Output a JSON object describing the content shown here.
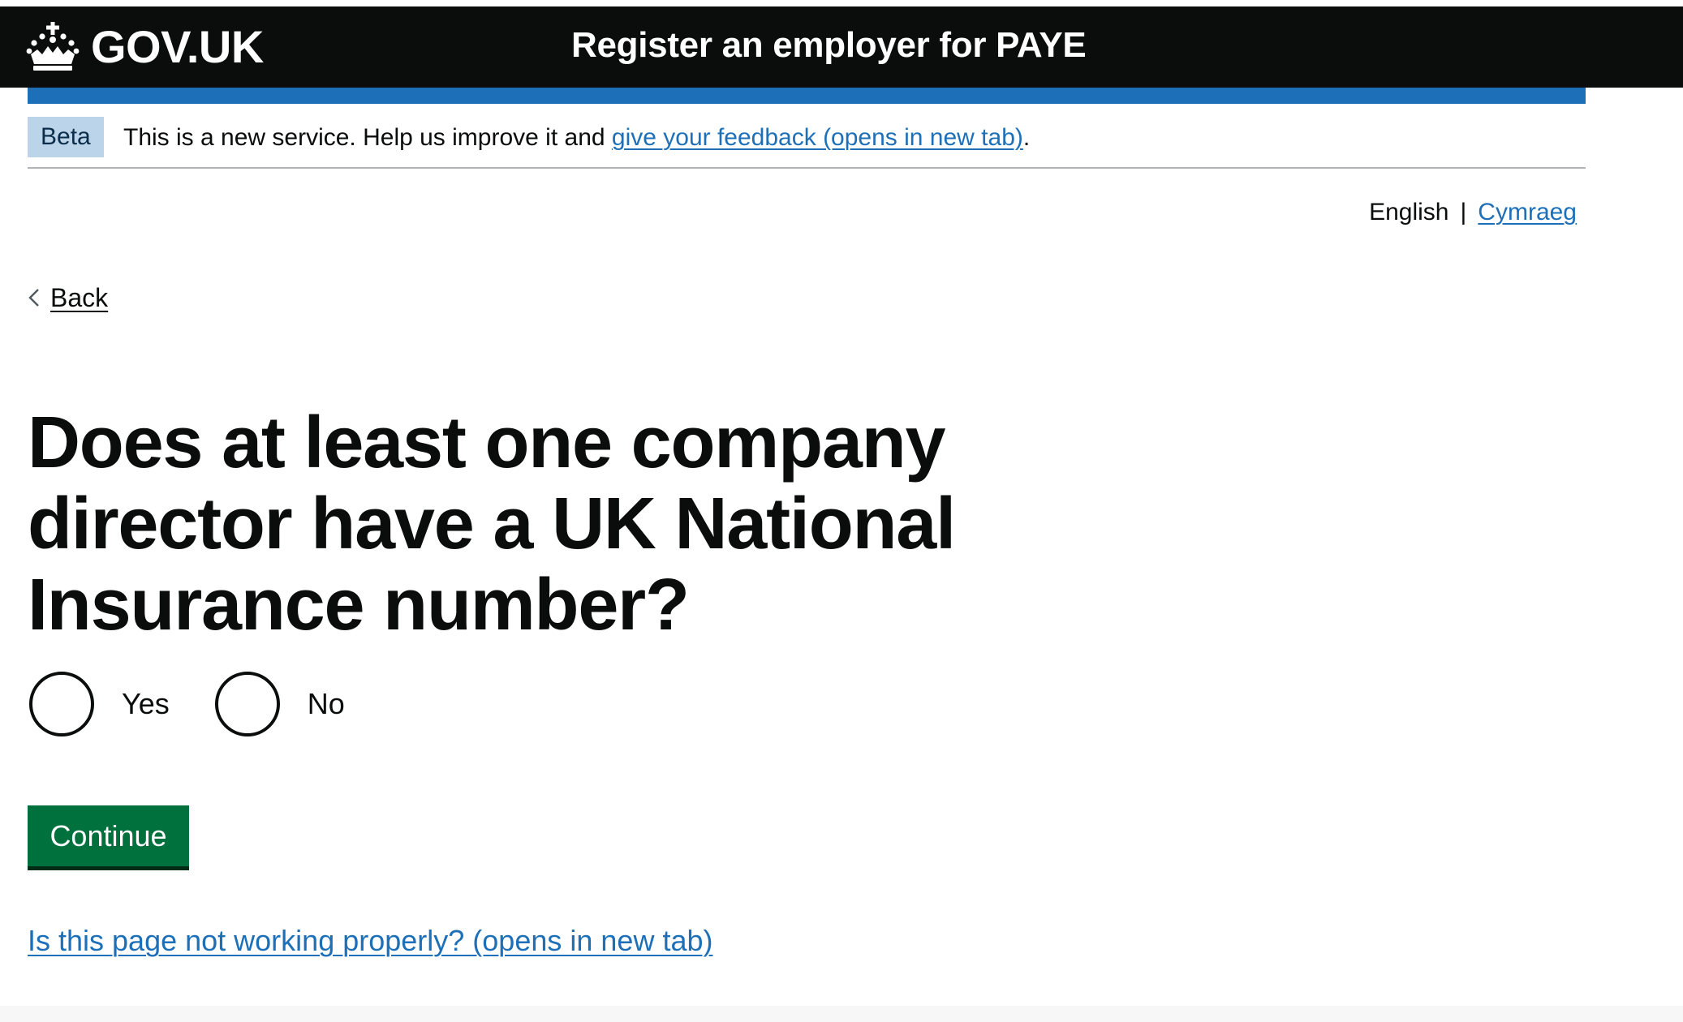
{
  "header": {
    "logo_text": "GOV.UK",
    "service_name": "Register an employer for PAYE"
  },
  "phase_banner": {
    "tag": "Beta",
    "text_before": "This is a new service. Help us improve it and ",
    "link_text": "give your feedback (opens in new tab)",
    "text_after": "."
  },
  "language": {
    "current": "English",
    "separator": "|",
    "other": "Cymraeg"
  },
  "back_link": {
    "label": "Back"
  },
  "question": {
    "heading": "Does at least one company director have a UK National Insurance number?",
    "options": [
      {
        "label": "Yes",
        "selected": false
      },
      {
        "label": "No",
        "selected": false
      }
    ]
  },
  "actions": {
    "continue_label": "Continue"
  },
  "footer": {
    "help_link": "Is this page not working properly? (opens in new tab)"
  },
  "colors": {
    "header_bg": "#0b0c0c",
    "brand_blue": "#1d70b8",
    "button_green": "#00703c",
    "tag_bg": "#bbd4ea"
  },
  "icons": {
    "logo": "crown-icon",
    "back": "chevron-left-icon"
  }
}
